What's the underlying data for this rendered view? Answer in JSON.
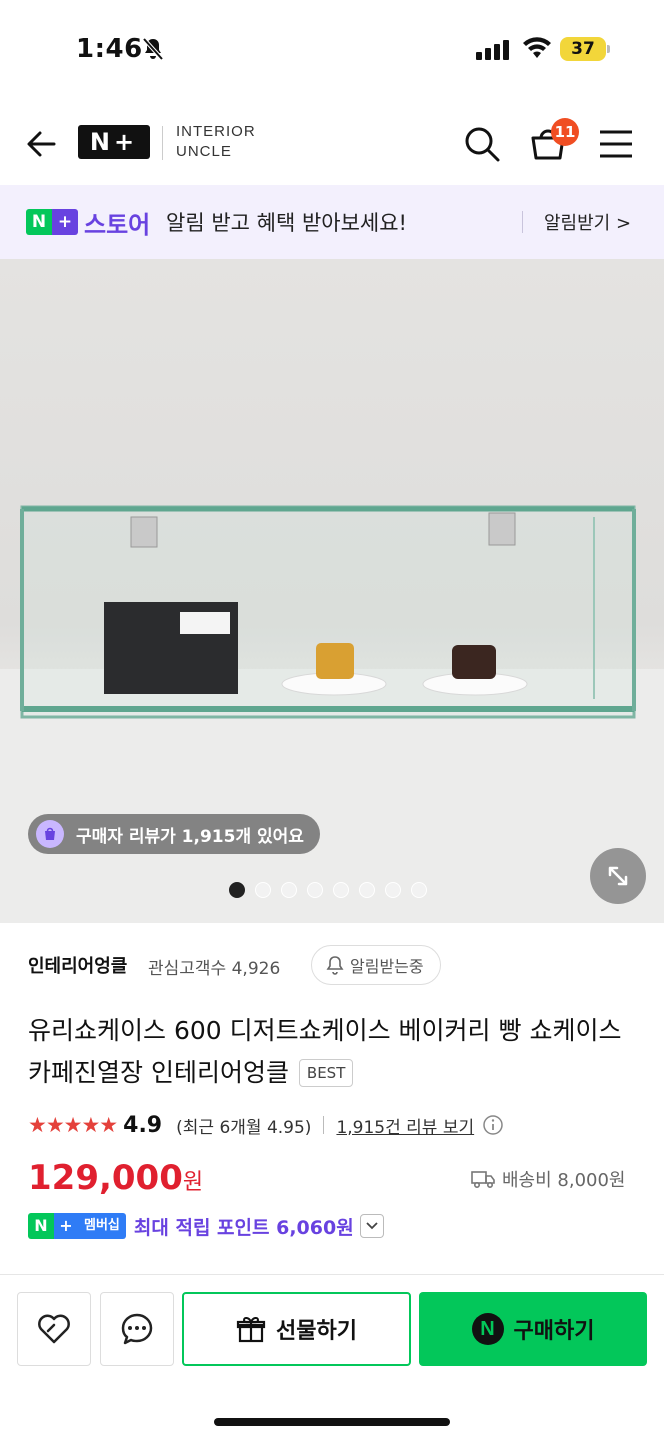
{
  "status_bar": {
    "time": "1:46",
    "battery": "37"
  },
  "header": {
    "logo_text": "N+",
    "brand_line1": "INTERIOR",
    "brand_line2": "UNCLE",
    "cart_count": "11"
  },
  "banner": {
    "n_letter": "N",
    "plus": "+",
    "store": "스토어",
    "message": "알림 받고 혜택 받아보세요!",
    "cta": "알림받기 >"
  },
  "product_image": {
    "review_pill": "구매자 리뷰가 1,915개 있어요",
    "total_images": 8,
    "active_image": 1
  },
  "seller": {
    "name": "인테리어엉클",
    "followers": "관심고객수 4,926",
    "alarm_button": "알림받는중"
  },
  "product": {
    "title": "유리쇼케이스 600 디저트쇼케이스 베이커리 빵 쇼케이스 카페진열장 인테리어엉클",
    "badge": "BEST",
    "stars": "★★★★★",
    "rating": "4.9",
    "recent_rating": "(최근 6개월 4.95)",
    "reviews_link": "1,915건 리뷰 보기",
    "price": "129,000",
    "currency": "원",
    "shipping": "배송비 8,000원",
    "membership_label": "멤버십",
    "points": "최대 적립 포인트 6,060원"
  },
  "bottom_bar": {
    "gift": "선물하기",
    "buy": "구매하기",
    "buy_icon": "N"
  },
  "colors": {
    "naver_green": "#03c75a",
    "store_purple": "#6842e0",
    "price_red": "#e0202f",
    "star_red": "#e4413b",
    "cart_badge": "#f04e23"
  }
}
